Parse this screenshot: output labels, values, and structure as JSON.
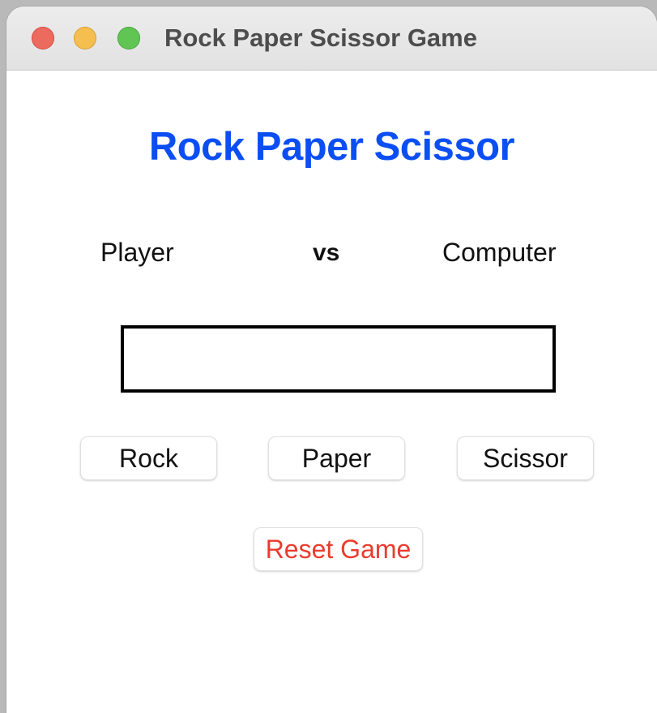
{
  "window": {
    "title": "Rock Paper Scissor Game"
  },
  "game": {
    "title": "Rock Paper Scissor",
    "player_label": "Player",
    "vs_label": "vs",
    "computer_label": "Computer",
    "result": ""
  },
  "buttons": {
    "rock": "Rock",
    "paper": "Paper",
    "scissor": "Scissor",
    "reset": "Reset Game"
  },
  "colors": {
    "title_blue": "#0b4ef4",
    "reset_red": "#ea3b2e",
    "close": "#ed6a5e",
    "minimize": "#f5bf4f",
    "zoom": "#61c554"
  }
}
